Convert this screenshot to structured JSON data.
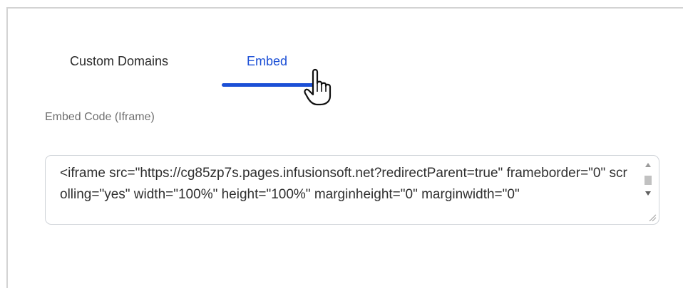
{
  "tabs": [
    {
      "label": "Custom Domains",
      "active": false
    },
    {
      "label": "Embed",
      "active": true
    }
  ],
  "embed_code": {
    "label": "Embed Code (Iframe)",
    "value": "<iframe src=\"https://cg85zp7s.pages.infusionsoft.net?redirectParent=true\" frameborder=\"0\" scrolling=\"yes\" width=\"100%\" height=\"100%\" marginheight=\"0\" marginwidth=\"0\""
  },
  "colors": {
    "accent": "#1b4fd6",
    "label": "#6e6e6e",
    "border": "#cfd3d8"
  },
  "icons": {
    "cursor": "hand-pointer-icon",
    "scroll_up": "arrow-up-icon",
    "scroll_down": "arrow-down-icon",
    "resize": "resize-handle-icon"
  }
}
